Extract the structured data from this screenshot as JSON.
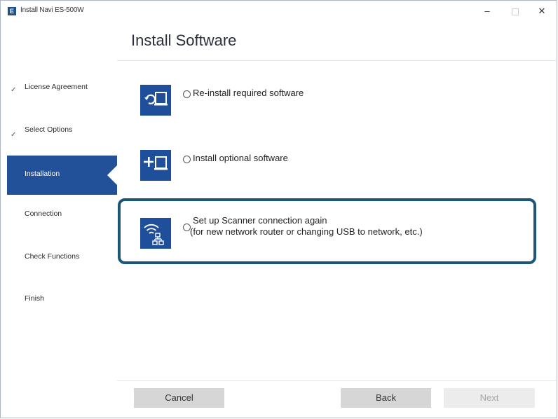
{
  "window": {
    "title": "Install Navi ES-500W",
    "icon_letter": "E",
    "minimize_glyph": "–",
    "close_glyph": "✕"
  },
  "sidebar": {
    "steps": [
      {
        "label": "License Agreement",
        "completed": true
      },
      {
        "label": "Select Options",
        "completed": true
      },
      {
        "label": "Installation",
        "active": true
      },
      {
        "label": "Connection"
      },
      {
        "label": "Check Functions"
      },
      {
        "label": "Finish"
      }
    ],
    "check_glyph": "✓",
    "active_color": "#22519a"
  },
  "main": {
    "title": "Install Software",
    "options": [
      {
        "icon": "reinstall-icon",
        "label": "Re-install required software",
        "selected": false
      },
      {
        "icon": "add-software-icon",
        "label": "Install optional software",
        "selected": false
      },
      {
        "icon": "network-connection-icon",
        "label": "Set up Scanner connection again",
        "sublabel": "(for new network router or changing USB to network, etc.)",
        "selected": false,
        "highlighted": true
      }
    ],
    "highlight_color": "#1c5677",
    "icon_color": "#1f4e9a"
  },
  "footer": {
    "cancel_label": "Cancel",
    "back_label": "Back",
    "next_label": "Next",
    "next_enabled": false
  }
}
